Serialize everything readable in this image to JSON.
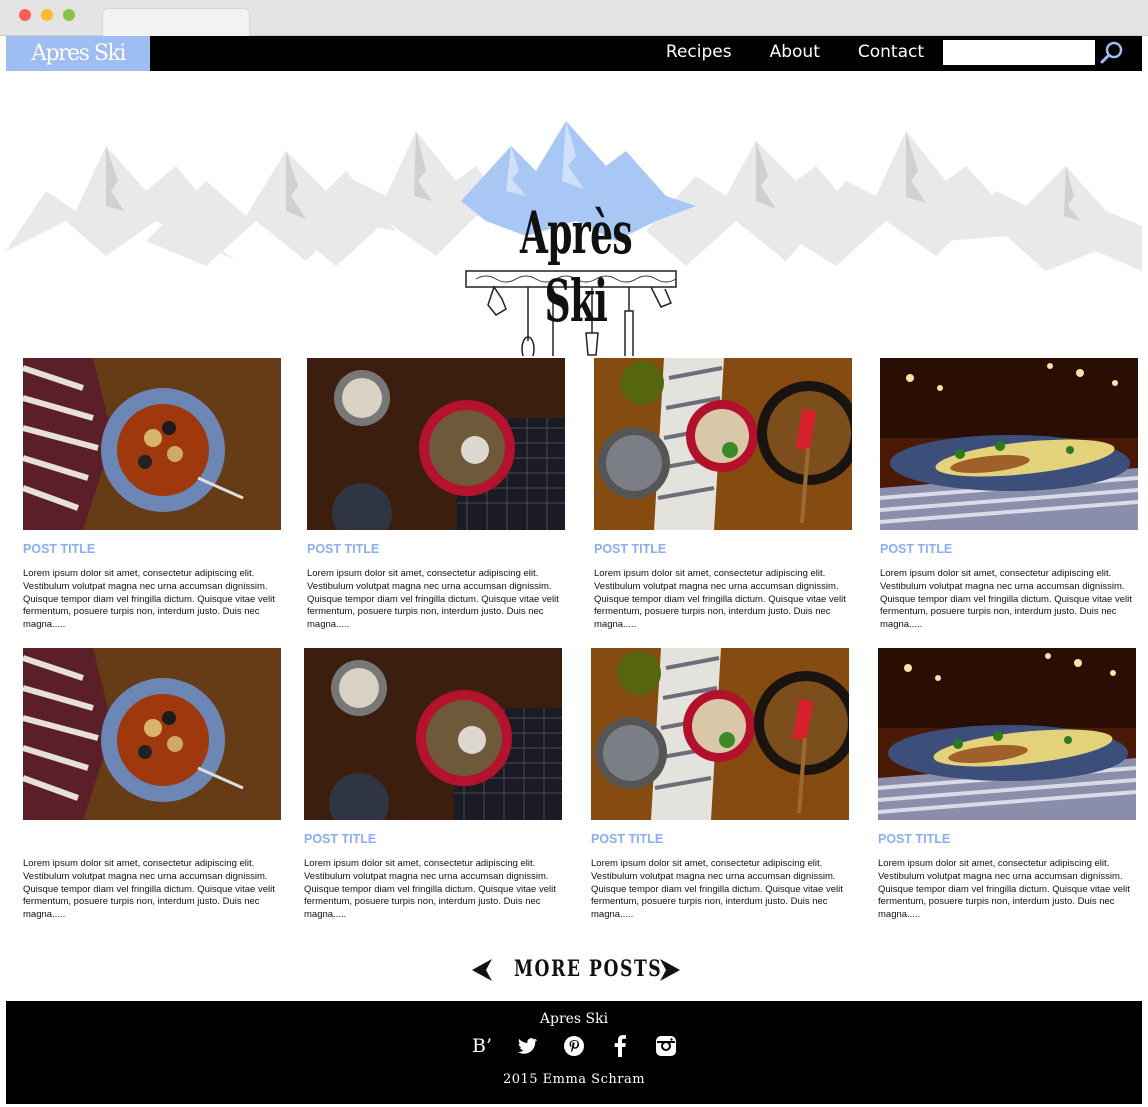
{
  "nav": {
    "brand": "Apres Ski",
    "links": [
      "Recipes",
      "About",
      "Contact"
    ],
    "search_placeholder": ""
  },
  "hero": {
    "title": "Après Ski"
  },
  "posts": [
    {
      "title": "POST TITLE",
      "body": "Lorem ipsum dolor sit amet, consectetur adipiscing elit. Vestibulum volutpat magna nec urna accumsan dignissim. Quisque tempor diam vel fringilla dictum. Quisque vitae velit fermentum, posuere turpis non, interdum justo. Duis nec magna.....",
      "image": "stew-bowl-photo"
    },
    {
      "title": "POST TITLE",
      "body": "Lorem ipsum dolor sit amet, consectetur adipiscing elit. Vestibulum volutpat magna nec urna accumsan dignissim. Quisque tempor diam vel fringilla dictum. Quisque vitae velit fermentum, posuere turpis non, interdum justo. Duis nec magna.....",
      "image": "rice-bowl-photo"
    },
    {
      "title": "POST TITLE",
      "body": "Lorem ipsum dolor sit amet, consectetur adipiscing elit. Vestibulum volutpat magna nec urna accumsan dignissim. Quisque tempor diam vel fringilla dictum. Quisque vitae velit fermentum, posuere turpis non, interdum justo. Duis nec magna.....",
      "image": "skillet-photo"
    },
    {
      "title": "POST TITLE",
      "body": "Lorem ipsum dolor sit amet, consectetur adipiscing elit. Vestibulum volutpat magna nec urna accumsan dignissim. Quisque tempor diam vel fringilla dictum. Quisque vitae velit fermentum, posuere turpis non, interdum justo. Duis nec magna.....",
      "image": "omelette-photo"
    },
    {
      "title": "",
      "body": "Lorem ipsum dolor sit amet, consectetur adipiscing elit. Vestibulum volutpat magna nec urna accumsan dignissim. Quisque tempor diam vel fringilla dictum. Quisque vitae velit fermentum, posuere turpis non, interdum justo. Duis nec magna.....",
      "image": "stew-bowl-photo"
    },
    {
      "title": "POST TITLE",
      "body": "Lorem ipsum dolor sit amet, consectetur adipiscing elit. Vestibulum volutpat magna nec urna accumsan dignissim. Quisque tempor diam vel fringilla dictum. Quisque vitae velit fermentum, posuere turpis non, interdum justo. Duis nec magna.....",
      "image": "rice-bowl-photo"
    },
    {
      "title": "POST TITLE",
      "body": "Lorem ipsum dolor sit amet, consectetur adipiscing elit. Vestibulum volutpat magna nec urna accumsan dignissim. Quisque tempor diam vel fringilla dictum. Quisque vitae velit fermentum, posuere turpis non, interdum justo. Duis nec magna.....",
      "image": "skillet-photo"
    },
    {
      "title": "POST TITLE",
      "body": "Lorem ipsum dolor sit amet, consectetur adipiscing elit. Vestibulum volutpat magna nec urna accumsan dignissim. Quisque tempor diam vel fringilla dictum. Quisque vitae velit fermentum, posuere turpis non, interdum justo. Duis nec magna.....",
      "image": "omelette-photo"
    }
  ],
  "more_posts": {
    "label": "MORE POSTS",
    "prev_icon": "chevron-left-icon",
    "next_icon": "chevron-right-icon"
  },
  "footer": {
    "title": "Apres Ski",
    "icons": [
      "bloglovin-icon",
      "twitter-icon",
      "pinterest-icon",
      "facebook-icon",
      "instagram-icon"
    ],
    "bloglovin_glyph": "B’",
    "copyright": "2015 Emma Schram"
  },
  "colors": {
    "accent": "#9dbdf3",
    "post_title": "#8aaef0",
    "nav_bg": "#000000"
  }
}
